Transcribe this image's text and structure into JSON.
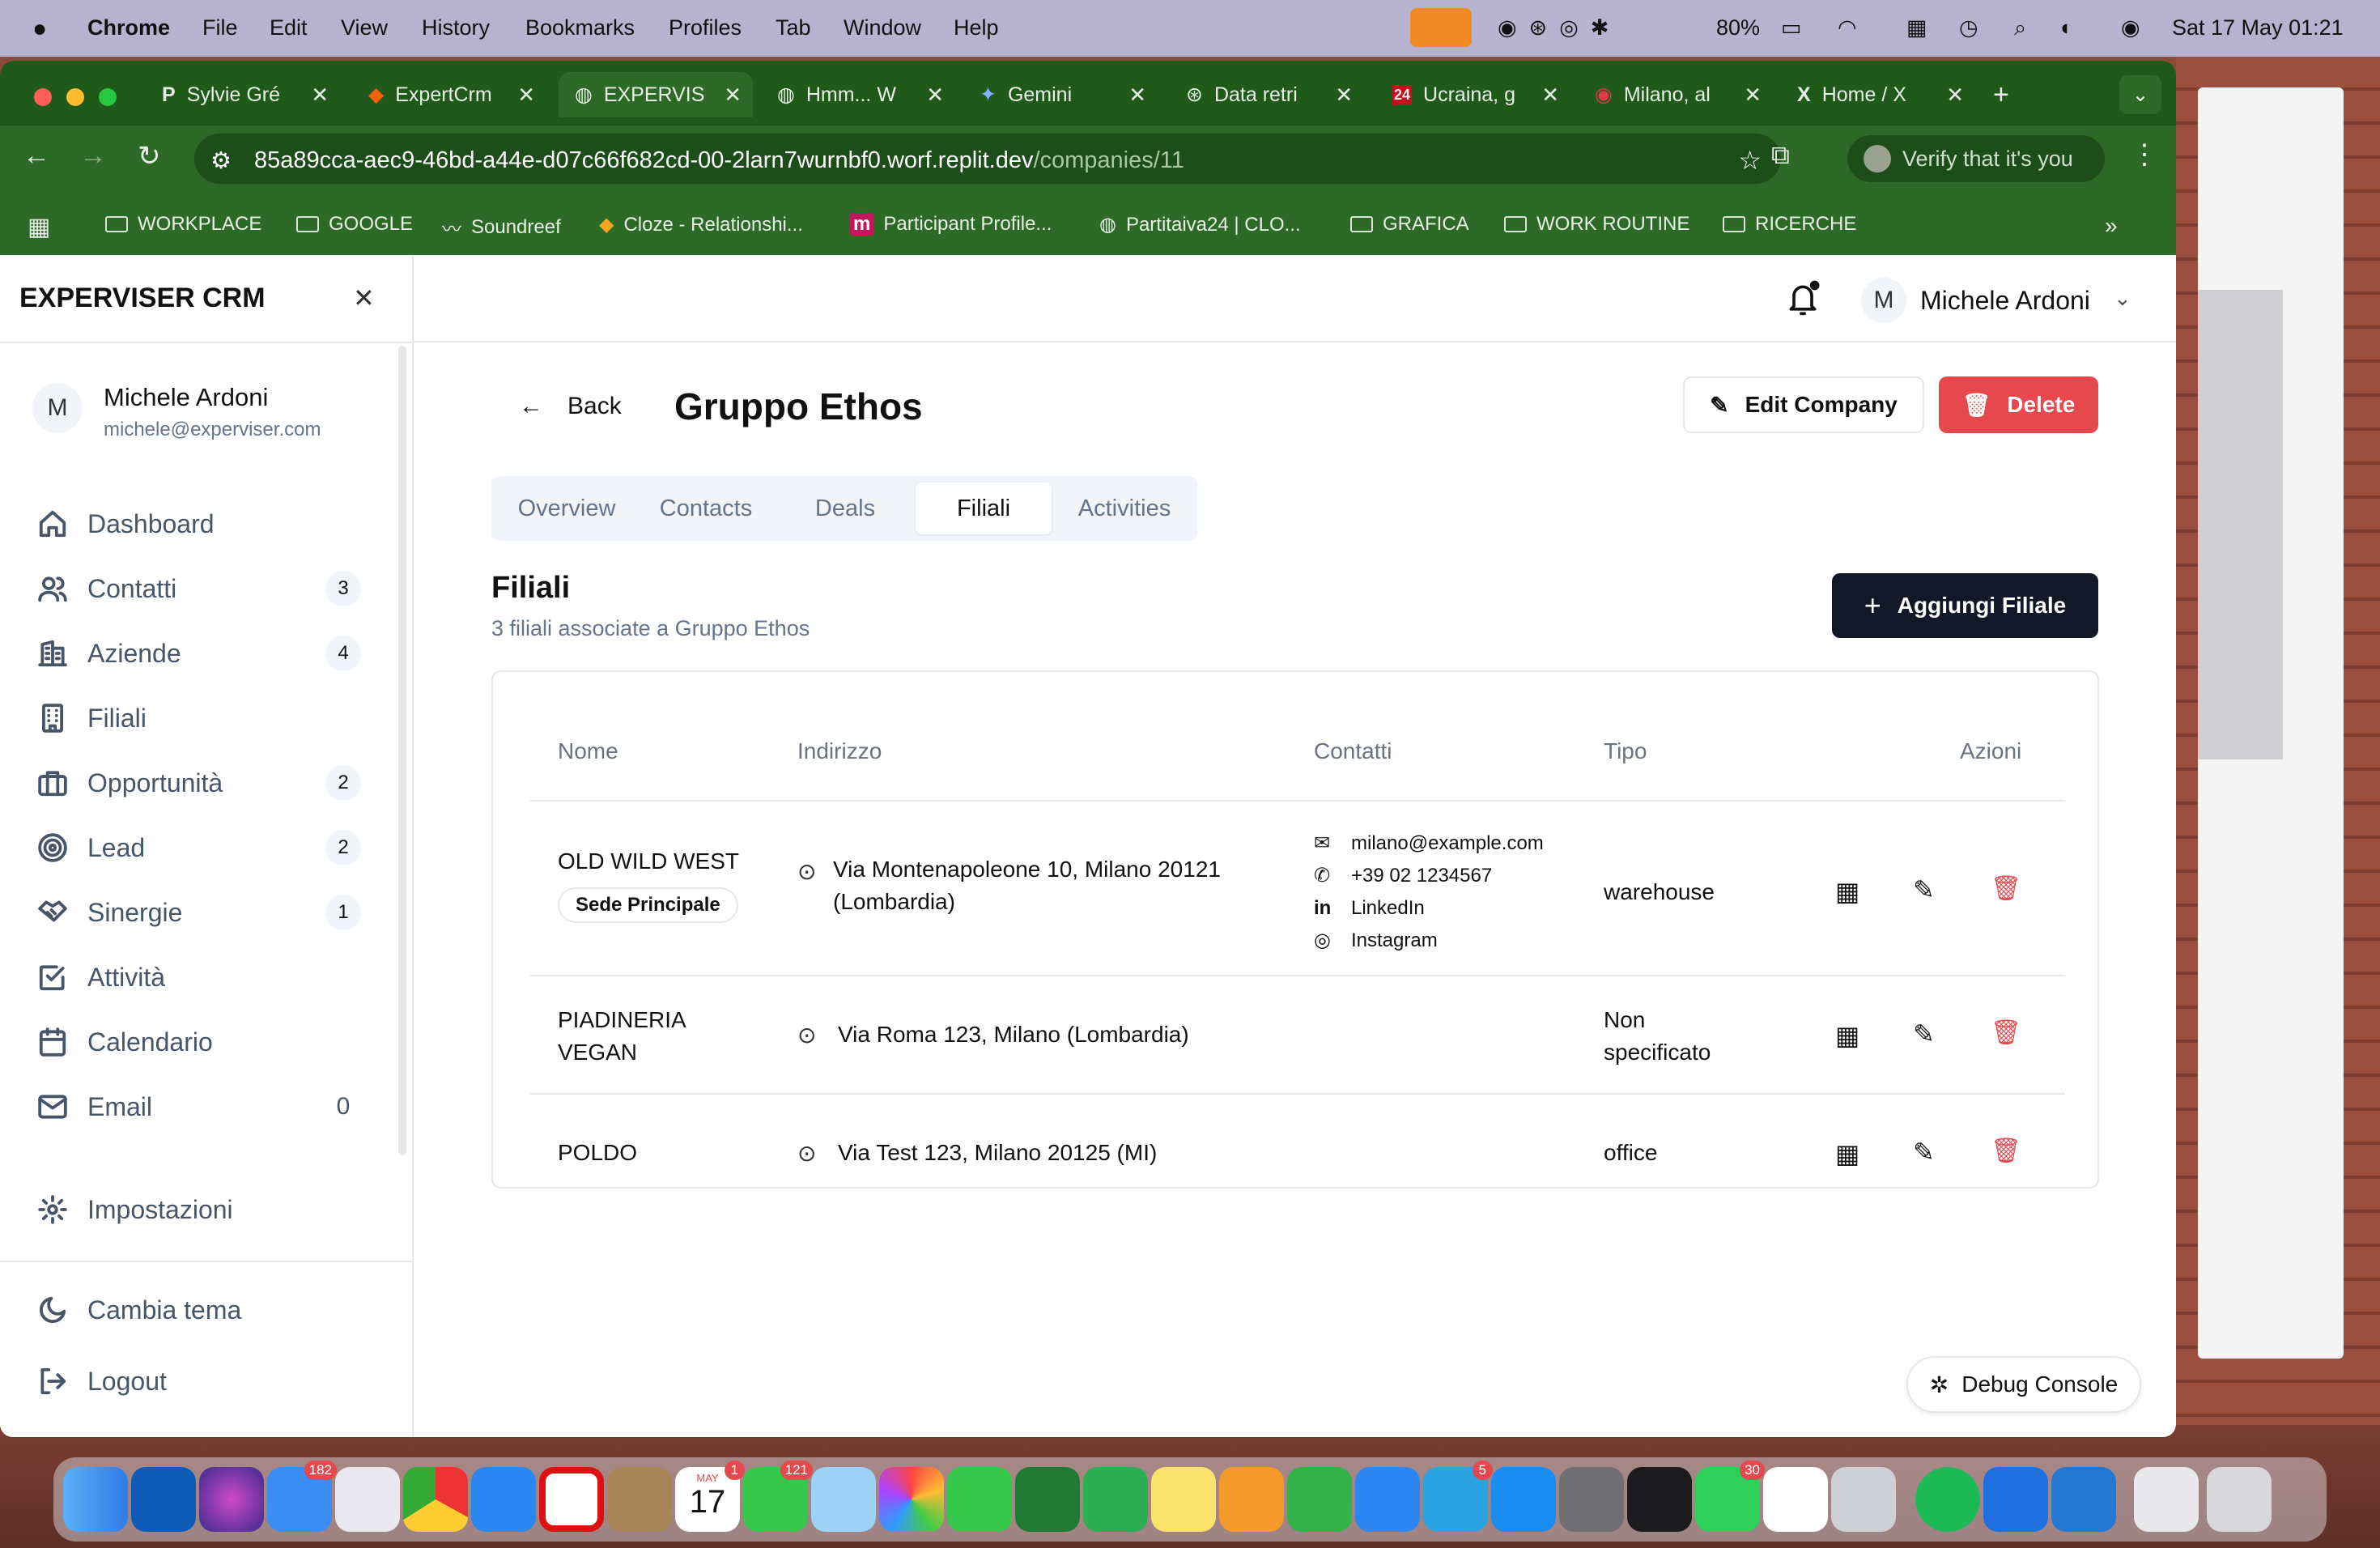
{
  "menubar": {
    "app": "Chrome",
    "items": [
      "File",
      "Edit",
      "View",
      "History",
      "Bookmarks",
      "Profiles",
      "Tab",
      "Window",
      "Help"
    ],
    "battery": "80%",
    "datetime": "Sat 17 May  01:21"
  },
  "tabs": [
    {
      "label": "Sylvie Gré",
      "icon": "P"
    },
    {
      "label": "ExpertCrm",
      "icon": "replit"
    },
    {
      "label": "EXPERVIS",
      "icon": "globe"
    },
    {
      "label": "Hmm... W",
      "icon": "globe"
    },
    {
      "label": "Gemini",
      "icon": "gemini"
    },
    {
      "label": "Data retri",
      "icon": "openai"
    },
    {
      "label": "Ucraina, g",
      "icon": "24"
    },
    {
      "label": "Milano, al",
      "icon": "news"
    },
    {
      "label": "Home / X",
      "icon": "X"
    }
  ],
  "address": {
    "host": "85a89cca-aec9-46bd-a44e-d07c66f682cd-00-2larn7wurnbf0.worf.replit.dev",
    "path": "/companies/11"
  },
  "profile_chip": "Verify that it's you",
  "bookmarks": [
    "WORKPLACE",
    "GOOGLE",
    "Soundreef",
    "Cloze - Relationshi...",
    "Participant Profile...",
    "Partitaiva24 | CLO...",
    "GRAFICA",
    "WORK ROUTINE",
    "RICERCHE"
  ],
  "app": {
    "name": "EXPERVISER CRM"
  },
  "user": {
    "initial": "M",
    "name": "Michele Ardoni",
    "email": "michele@experviser.com"
  },
  "nav": [
    {
      "label": "Dashboard",
      "count": ""
    },
    {
      "label": "Contatti",
      "count": "3"
    },
    {
      "label": "Aziende",
      "count": "4"
    },
    {
      "label": "Filiali",
      "count": ""
    },
    {
      "label": "Opportunità",
      "count": "2"
    },
    {
      "label": "Lead",
      "count": "2"
    },
    {
      "label": "Sinergie",
      "count": "1"
    },
    {
      "label": "Attività",
      "count": ""
    },
    {
      "label": "Calendario",
      "count": ""
    },
    {
      "label": "Email",
      "count": "0"
    }
  ],
  "settings_label": "Impostazioni",
  "theme_label": "Cambia tema",
  "logout_label": "Logout",
  "header": {
    "initial": "M",
    "user_name": "Michele Ardoni"
  },
  "company": {
    "back": "Back",
    "name": "Gruppo Ethos",
    "edit": "Edit Company",
    "delete": "Delete"
  },
  "tabs_inner": [
    "Overview",
    "Contacts",
    "Deals",
    "Filiali",
    "Activities"
  ],
  "section": {
    "title": "Filiali",
    "subtitle": "3 filiali associate a Gruppo Ethos",
    "add_button": "Aggiungi Filiale"
  },
  "table": {
    "headers": [
      "Nome",
      "Indirizzo",
      "Contatti",
      "Tipo",
      "Azioni"
    ],
    "rows": [
      {
        "name": "OLD WILD WEST",
        "badge": "Sede Principale",
        "address": "Via Montenapoleone 10, Milano 20121 (Lombardia)",
        "email": "milano@example.com",
        "phone": "+39 02 1234567",
        "linkedin": "LinkedIn",
        "instagram": "Instagram",
        "type": "warehouse"
      },
      {
        "name": "PIADINERIA VEGAN",
        "address": "Via Roma 123, Milano (Lombardia)",
        "type": "Non specificato"
      },
      {
        "name": "POLDO",
        "address": "Via Test 123, Milano 20125 (MI)",
        "type": "office"
      }
    ]
  },
  "debug_label": "Debug Console",
  "dock": {
    "badges": {
      "mail": "182",
      "calendar": "1",
      "messages": "121",
      "telegram": "5",
      "whatsapp": "30"
    },
    "calendar_day": "17",
    "calendar_month": "MAY"
  },
  "colors": {
    "danger": "#e5484d",
    "primary": "#111827",
    "chrome_green": "#2d6a27"
  }
}
